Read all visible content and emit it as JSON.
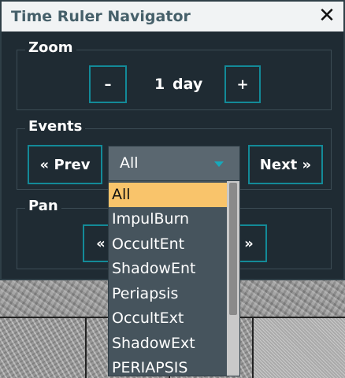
{
  "window": {
    "title": "Time Ruler Navigator",
    "close_glyph": "✕"
  },
  "zoom": {
    "legend": "Zoom",
    "minus_label": "–",
    "value": "1",
    "unit": "day",
    "plus_label": "+"
  },
  "events": {
    "legend": "Events",
    "prev_label": "« Prev",
    "next_label": "Next »",
    "selected": "All",
    "options": [
      "All",
      "ImpulBurn",
      "OccultEnt",
      "ShadowEnt",
      "Periapsis",
      "OccultExt",
      "ShadowExt",
      "PERIAPSIS"
    ]
  },
  "pan": {
    "legend": "Pan",
    "left_label": "«",
    "right_label": "»"
  },
  "colors": {
    "accent": "#138a98",
    "highlight": "#f9c46b",
    "window_bg": "#1f2b33"
  }
}
